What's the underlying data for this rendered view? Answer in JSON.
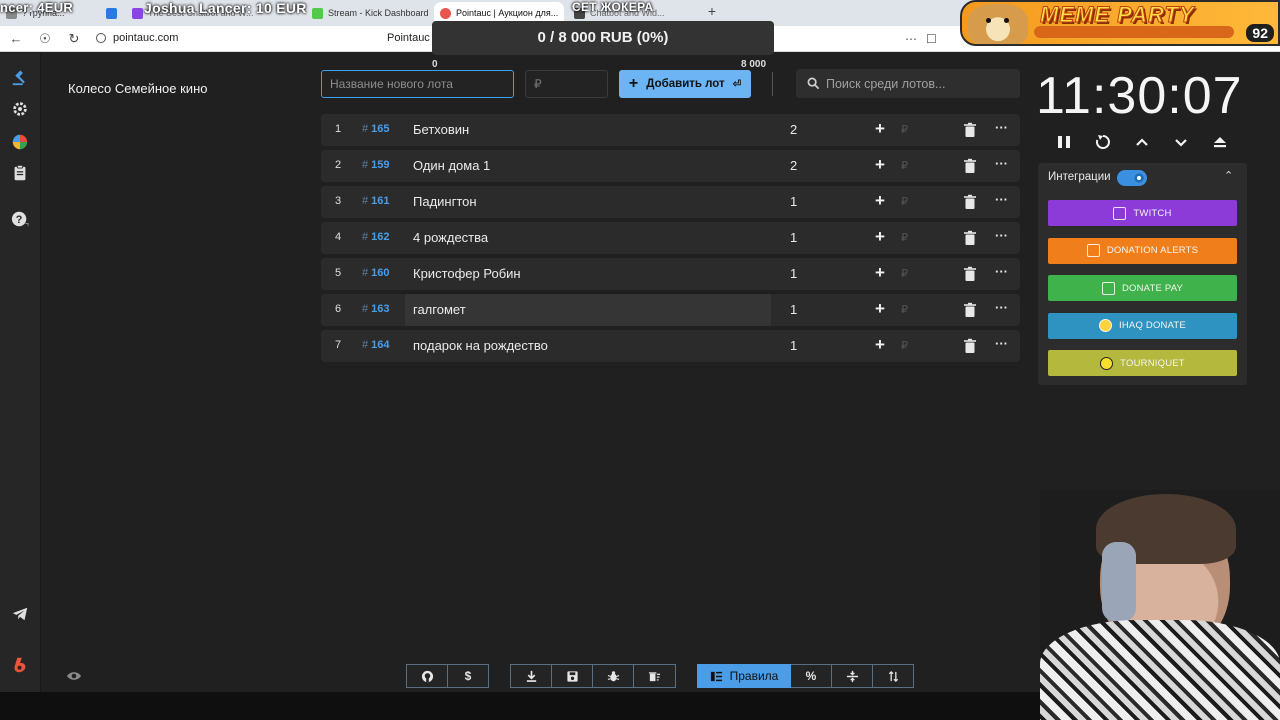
{
  "browser": {
    "tabs": [
      {
        "label": "? группа...",
        "color": "#8a8a8a"
      },
      {
        "label": "",
        "color": "#2a7ae2"
      },
      {
        "label": "The Best Chatbot and W...",
        "color": "#8b45e6"
      },
      {
        "label": "Stream - Kick Dashboard",
        "color": "#53c94a"
      },
      {
        "label": "Pointauc | Аукцион для...",
        "color": "#e8554e"
      },
      {
        "label": "Chatbot and Wid...",
        "color": "#444444"
      }
    ],
    "overlay_texts": [
      "ncer: 4EUR",
      "Joshua Lancer: 10 EUR",
      "СЕТ ЖОКЕРА"
    ],
    "url": "pointauc.com",
    "tab_title_center": "Pointauc |"
  },
  "meme_overlay": {
    "title": "MEME PARTY",
    "score": "92"
  },
  "app": {
    "wheel_title": "Колесо Семейное кино",
    "progress": {
      "text": "0 / 8 000 RUB (0%)",
      "min": "0",
      "max": "8 000",
      "fraction": 0
    },
    "new_lot": {
      "name_placeholder": "Название нового лота",
      "price_placeholder": "₽",
      "add_label": "Добавить лот"
    },
    "search": {
      "placeholder": "Поиск среди лотов..."
    },
    "lots": [
      {
        "index": "1",
        "id": "165",
        "name": "Бетховин",
        "amount": "2",
        "currency": "₽"
      },
      {
        "index": "2",
        "id": "159",
        "name": "Один дома 1",
        "amount": "2",
        "currency": "₽"
      },
      {
        "index": "3",
        "id": "161",
        "name": "Падингтон",
        "amount": "1",
        "currency": "₽"
      },
      {
        "index": "4",
        "id": "162",
        "name": " 4 рождества",
        "amount": "1",
        "currency": "₽"
      },
      {
        "index": "5",
        "id": "160",
        "name": " Кристофер Робин",
        "amount": "1",
        "currency": "₽"
      },
      {
        "index": "6",
        "id": "163",
        "name": " галгомет",
        "amount": "1",
        "currency": "₽"
      },
      {
        "index": "7",
        "id": "164",
        "name": "подарок на рождество",
        "amount": "1",
        "currency": "₽"
      }
    ],
    "timer": "11:30:07",
    "integrations": {
      "header": "Интеграции",
      "enabled": true,
      "buttons": [
        {
          "label": "TWITCH",
          "color": "#8d3bd8",
          "icon": "twitch-icon"
        },
        {
          "label": "DONATION ALERTS",
          "color": "#f07f1b",
          "icon": "donation-alerts-icon"
        },
        {
          "label": "DONATE PAY",
          "color": "#40b24b",
          "icon": "donatepay-icon"
        },
        {
          "label": "IHAQ DONATE",
          "color": "#2f93c2",
          "icon": "ihaq-icon"
        },
        {
          "label": "TOURNIQUET",
          "color": "#b4b83c",
          "icon": "tourniquet-icon"
        }
      ]
    },
    "toolbar": {
      "rules_label": "Правила",
      "percent_label": "%"
    }
  }
}
